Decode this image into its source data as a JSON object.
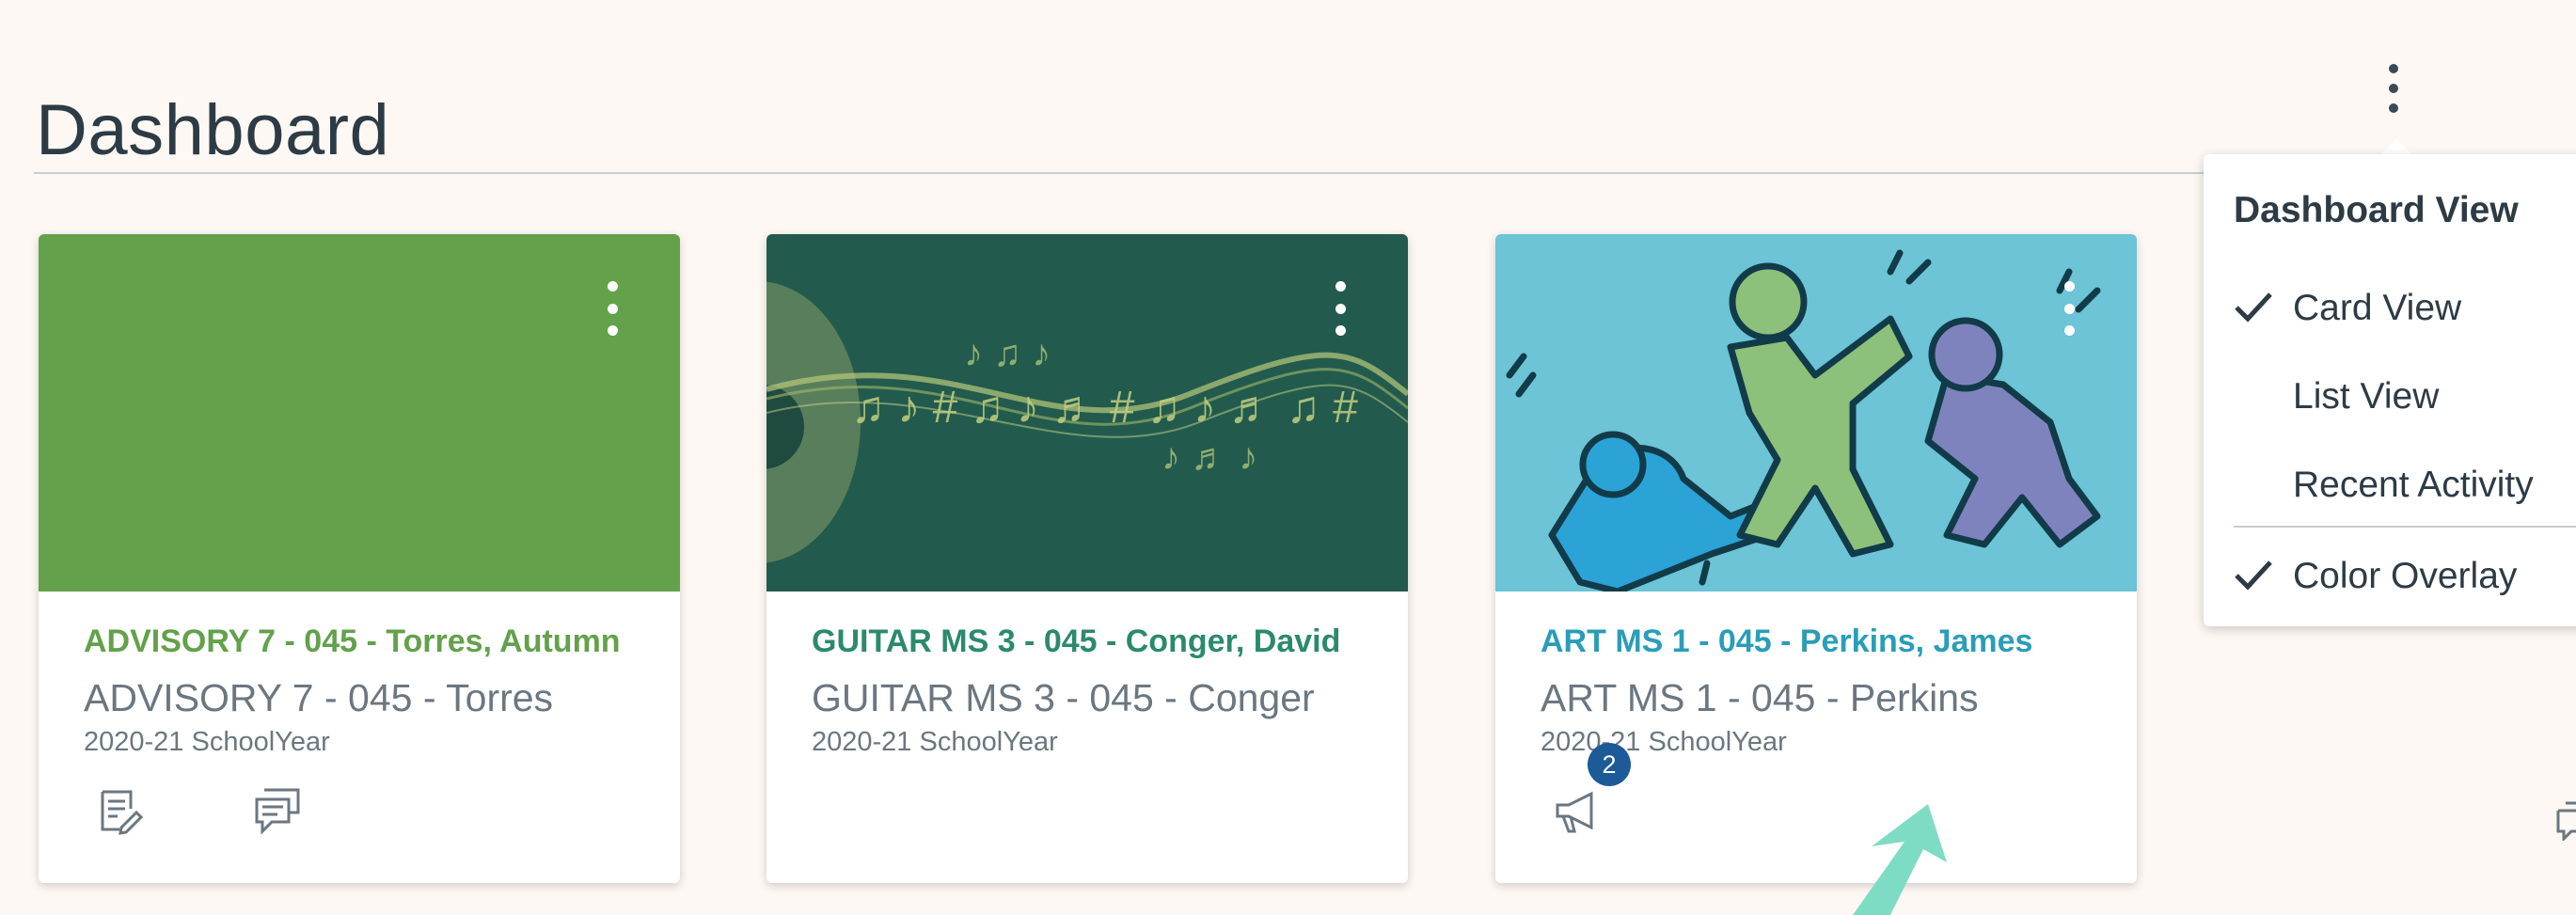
{
  "page": {
    "title": "Dashboard"
  },
  "menu": {
    "heading": "Dashboard View",
    "items": [
      {
        "label": "Card View",
        "checked": true
      },
      {
        "label": "List View",
        "checked": false
      },
      {
        "label": "Recent Activity",
        "checked": false
      },
      {
        "label": "Color Overlay",
        "checked": true
      }
    ]
  },
  "cards": [
    {
      "title": "ADVISORY 7 - 045 - Torres, Autumn",
      "subtitle": "ADVISORY 7 - 045 - Torres",
      "term": "2020-21 SchoolYear",
      "color": "#63a14b",
      "icons": [
        "assignments-icon",
        "discussions-icon"
      ]
    },
    {
      "title": "GUITAR MS 3 - 045 - Conger, David",
      "subtitle": "GUITAR MS 3 - 045 - Conger",
      "term": "2020-21 SchoolYear",
      "color": "#225b4d",
      "icons": []
    },
    {
      "title": "ART MS 1 - 045 - Perkins, James",
      "subtitle": "ART MS 1 - 045 - Perkins",
      "term": "2020-21 SchoolYear",
      "color": "#2a9db8",
      "icons": [
        "announcements-icon"
      ],
      "badge": "2"
    }
  ],
  "colors": {
    "text": "#2d3b45",
    "muted": "#6b7780",
    "badge": "#1c5b97",
    "cursor": "#7fdcc4"
  }
}
